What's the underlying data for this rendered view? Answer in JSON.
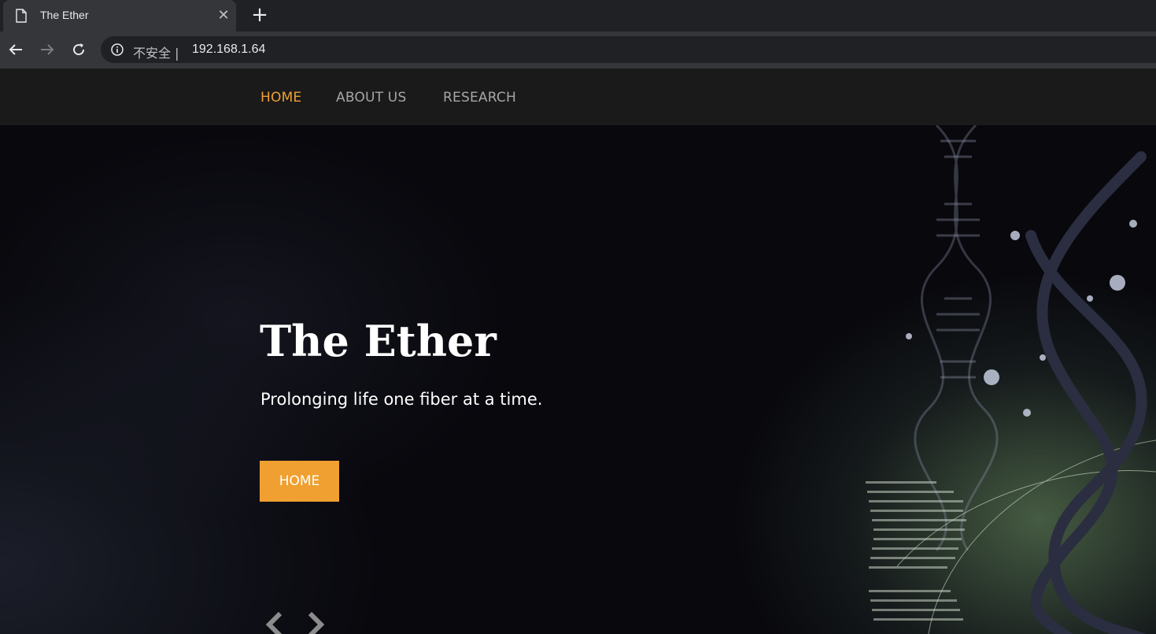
{
  "browser": {
    "tab_title": "The Ether",
    "tab_icon": "page-icon",
    "close_icon": "close-icon",
    "new_tab_icon": "plus-icon",
    "security_label": "不安全 |",
    "url": "192.168.1.64"
  },
  "nav": {
    "items": [
      {
        "label": "HOME",
        "active": true
      },
      {
        "label": "ABOUT US",
        "active": false
      },
      {
        "label": "RESEARCH",
        "active": false
      }
    ]
  },
  "hero": {
    "title": "The Ether",
    "tagline": "Prolonging life one fiber at a time.",
    "button_label": "HOME"
  },
  "colors": {
    "accent": "#f0a030",
    "nav_bg": "#1a1a1a",
    "nav_text": "#a6a6a6",
    "chrome_bg": "#202124"
  }
}
